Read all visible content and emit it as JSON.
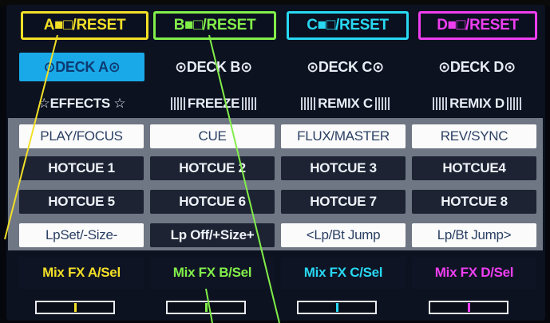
{
  "reset_buttons": [
    {
      "label": "A■□/RESET",
      "color": "#f2df27"
    },
    {
      "label": "B■□/RESET",
      "color": "#82ee4a"
    },
    {
      "label": "C■□/RESET",
      "color": "#28d8f2"
    },
    {
      "label": "D■□/RESET",
      "color": "#ee3ef0"
    }
  ],
  "decks": [
    "⊙DECK A⊙",
    "⊙DECK B⊙",
    "⊙DECK C⊙",
    "⊙DECK D⊙"
  ],
  "effects": {
    "effects_label": "☆EFFECTS ☆",
    "freeze_label": "FREEZE",
    "remix_c_label": "REMIX C",
    "remix_d_label": "REMIX D"
  },
  "pads": {
    "row1": [
      "PLAY/FOCUS",
      "CUE",
      "FLUX/MASTER",
      "REV/SYNC"
    ],
    "row2": [
      "HOTCUE 1",
      "HOTCUE 2",
      "HOTCUE 3",
      "HOTCUE4"
    ],
    "row3": [
      "HOTCUE 5",
      "HOTCUE 6",
      "HOTCUE 7",
      "HOTCUE 8"
    ],
    "row4": [
      "LpSet/-Size-",
      "Lp Off/+Size+",
      "<Lp/Bt Jump",
      "Lp/Bt Jump>"
    ]
  },
  "mixfx": [
    {
      "label": "Mix FX A/Sel",
      "color": "#f2df27"
    },
    {
      "label": "Mix FX B/Sel",
      "color": "#82ee4a"
    },
    {
      "label": "Mix FX C/Sel",
      "color": "#28d8f2"
    },
    {
      "label": "Mix FX D/Sel",
      "color": "#ee3ef0"
    }
  ],
  "meters": [
    {
      "level": 0.5,
      "color": "#f2df27"
    },
    {
      "level": 0.5,
      "color": "#82ee4a"
    },
    {
      "level": 0.5,
      "color": "#28d8f2"
    },
    {
      "level": 0.5,
      "color": "#ee3ef0"
    }
  ]
}
